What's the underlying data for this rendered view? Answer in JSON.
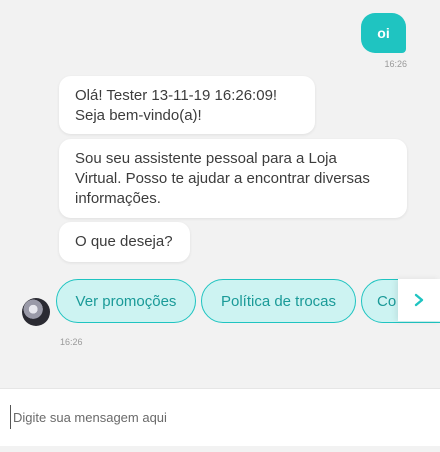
{
  "user_message": {
    "text": "oi",
    "time": "16:26",
    "color": "#1fc4c1"
  },
  "bot": {
    "avatar_icon": "bot-avatar",
    "messages": [
      {
        "lines": [
          "Olá! Tester 13-11-19 16:26:09!",
          "Seja bem-vindo(a)!"
        ]
      },
      {
        "lines": [
          "Sou seu assistente pessoal para a Loja",
          "Virtual. Posso te ajudar a encontrar diversas",
          "informações."
        ]
      },
      {
        "lines": [
          "O que deseja?"
        ]
      }
    ],
    "time": "16:26"
  },
  "quick_replies": [
    {
      "label": "Ver promoções"
    },
    {
      "label": "Política de trocas"
    },
    {
      "label": "Co"
    }
  ],
  "carousel_next_icon": "chevron-right-icon",
  "composer": {
    "placeholder": "Digite sua mensagem aqui",
    "value": ""
  },
  "colors": {
    "accent": "#1fc4c1",
    "chip_bg": "#cdf3f2",
    "chip_text": "#1a9a98",
    "background": "#f2f2f2"
  }
}
